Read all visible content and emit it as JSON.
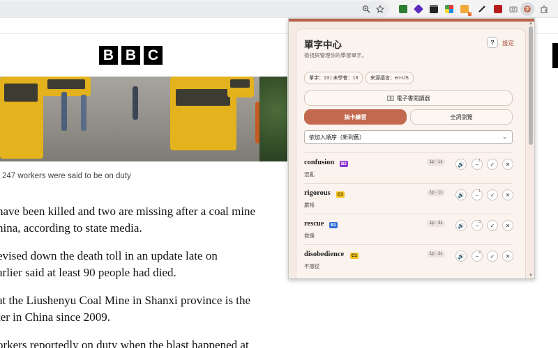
{
  "browser": {
    "toolbar_icons": [
      "zoom-icon",
      "star-icon",
      "ext-icon"
    ],
    "ext_badge": "0"
  },
  "article": {
    "caption": "247 workers were said to be on duty",
    "paragraphs": [
      "have been killed and two are missing after a coal mine",
      "hina, according to state media.",
      "evised down the death toll in an update late on",
      "arlier said at least 90 people had died.",
      "at the Liushenyu Coal Mine in Shanxi province is the",
      "ter in China since 2009.",
      "orkers reportedly on duty when the blast happened at"
    ],
    "logo": [
      "B",
      "B",
      "C"
    ]
  },
  "popup": {
    "title": "單字中心",
    "subtitle": "檢視與管理你的學習單字。",
    "help_label": "?",
    "settings_label": "設定",
    "chip_counts": "單字：13 | 未學會：13",
    "chip_lang": "來源語言：en-US",
    "reader_label": "電子書閱讀器",
    "mode_flashcard": "抽卡練習",
    "mode_browse": "全詞瀏覽",
    "sort_value": "依加入順序（新到舊）",
    "words": [
      {
        "word": "confusion",
        "level": "B2",
        "meaning": "混亂",
        "stat": "1p · 1x",
        "count": "1"
      },
      {
        "word": "rigorous",
        "level": "C1",
        "meaning": "嚴格",
        "stat": "1p · 1x",
        "count": "1"
      },
      {
        "word": "rescue",
        "level": "B1",
        "meaning": "救援",
        "stat": "1p · 3x",
        "count": "3"
      },
      {
        "word": "disobedience",
        "level": "C1",
        "meaning": "不服從",
        "stat": "1p · 2x",
        "count": "2"
      }
    ],
    "colors": {
      "accent": "#c2694f",
      "b2": "#8e2fd6",
      "b1": "#2f6fd6",
      "c1": "#f2c21b"
    }
  }
}
